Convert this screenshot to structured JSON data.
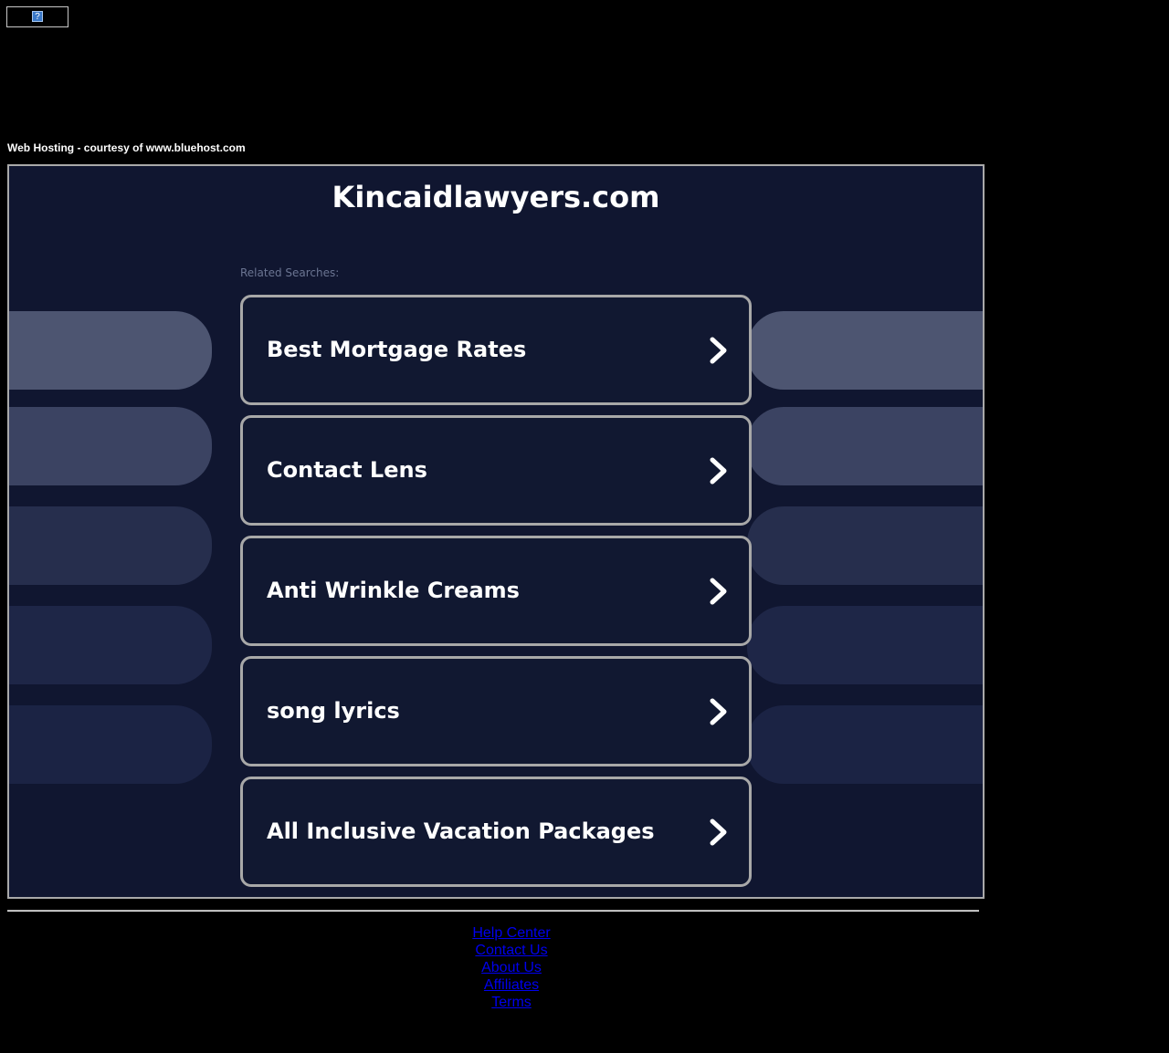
{
  "header": {
    "broken_image_glyph": "?",
    "courtesy_text": "Web Hosting - courtesy of www.bluehost.com"
  },
  "main": {
    "site_title": "Kincaidlawyers.com",
    "related_label": "Related Searches:",
    "searches": [
      {
        "label": "Best Mortgage Rates"
      },
      {
        "label": "Contact Lens"
      },
      {
        "label": "Anti Wrinkle Creams"
      },
      {
        "label": "song lyrics"
      },
      {
        "label": "All Inclusive Vacation Packages"
      }
    ],
    "icons": {
      "search_arrow": "chevron-right-icon"
    }
  },
  "footer": {
    "links": [
      {
        "label": "Help Center"
      },
      {
        "label": "Contact Us"
      },
      {
        "label": "About Us"
      },
      {
        "label": "Affiliates"
      },
      {
        "label": "Terms"
      }
    ]
  },
  "colors": {
    "page_background": "#000000",
    "frame_background": "#101630",
    "card_border": "#a8a8a8",
    "link": "#0000ee",
    "pill_shades": [
      "#4d5571",
      "#3b4362",
      "#262e4d",
      "#1e2647",
      "#1b2344"
    ]
  }
}
